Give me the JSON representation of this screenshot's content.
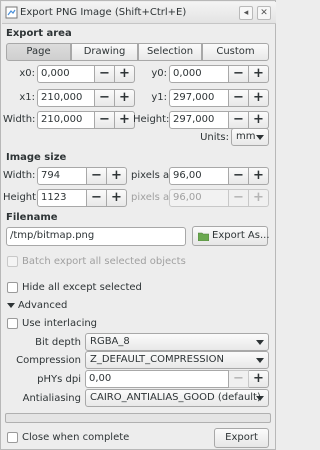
{
  "window": {
    "title": "Export PNG Image (Shift+Ctrl+E)",
    "pin_glyph": "◂",
    "close_glyph": "✕"
  },
  "export_area": {
    "title": "Export area",
    "tabs": [
      "Page",
      "Drawing",
      "Selection",
      "Custom"
    ],
    "active_tab": "Page",
    "x0_label": "x0:",
    "x0": "0,000",
    "y0_label": "y0:",
    "y0": "0,000",
    "x1_label": "x1:",
    "x1": "210,000",
    "y1_label": "y1:",
    "y1": "297,000",
    "width_label": "Width:",
    "width": "210,000",
    "height_label": "Height:",
    "height": "297,000",
    "units_label": "Units:",
    "units": "mm"
  },
  "image_size": {
    "title": "Image size",
    "width_label": "Width:",
    "width": "794",
    "height_label": "Height:",
    "height": "1123",
    "pixels_at_label": "pixels at",
    "dpi_x": "96,00",
    "dpi_y": "96,00",
    "dpi_label": "dpi"
  },
  "filename": {
    "title": "Filename",
    "value": "/tmp/bitmap.png",
    "export_as_label": "Export As..."
  },
  "options": {
    "batch_export_label": "Batch export all selected objects",
    "hide_all_label": "Hide all except selected"
  },
  "advanced": {
    "title": "Advanced",
    "use_interlacing_label": "Use interlacing",
    "bit_depth_label": "Bit depth",
    "bit_depth": "RGBA_8",
    "compression_label": "Compression",
    "compression": "Z_DEFAULT_COMPRESSION",
    "phys_label": "pHYs dpi",
    "phys": "0,00",
    "antialiasing_label": "Antialiasing",
    "antialiasing": "CAIRO_ANTIALIAS_GOOD (default)"
  },
  "footer": {
    "close_when_complete_label": "Close when complete",
    "export_label": "Export",
    "progress": 0
  },
  "buttons": {
    "minus": "−",
    "plus": "+"
  },
  "colors": {
    "accent": "#4a90d9",
    "folder_icon": "#6aa84f"
  }
}
